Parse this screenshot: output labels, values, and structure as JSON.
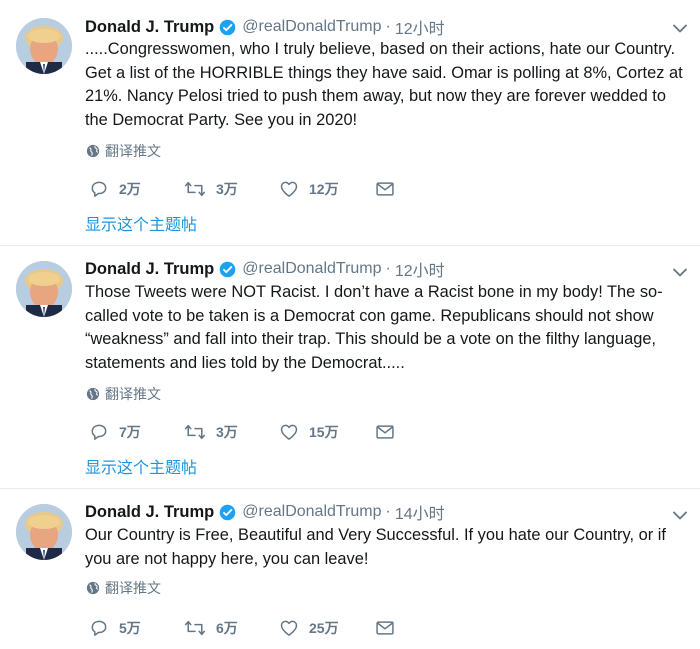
{
  "colors": {
    "accent": "#1b95e0",
    "muted": "#657786",
    "text": "#14171a",
    "divider": "#e6ecf0"
  },
  "tweets": [
    {
      "name": "Donald J. Trump",
      "handle": "@realDonaldTrump",
      "separator": "·",
      "time": "12小时",
      "text": ".....Congresswomen, who I truly believe, based on their actions, hate our Country. Get a list of the HORRIBLE things they have said. Omar is polling at 8%, Cortez at 21%. Nancy Pelosi tried to push them away, but now they are forever wedded to the Democrat Party. See you in 2020!",
      "translate": "翻译推文",
      "replies": "2万",
      "retweets": "3万",
      "likes": "12万",
      "show_thread": "显示这个主题帖"
    },
    {
      "name": "Donald J. Trump",
      "handle": "@realDonaldTrump",
      "separator": "·",
      "time": "12小时",
      "text": "Those Tweets were NOT Racist. I don’t have a Racist bone in my body! The so-called vote to be taken is a Democrat con game. Republicans should not show “weakness” and fall into their trap. This should be a vote on the filthy language, statements and lies told by the Democrat.....",
      "translate": "翻译推文",
      "replies": "7万",
      "retweets": "3万",
      "likes": "15万",
      "show_thread": "显示这个主题帖"
    },
    {
      "name": "Donald J. Trump",
      "handle": "@realDonaldTrump",
      "separator": "·",
      "time": "14小时",
      "text": "Our Country is Free, Beautiful and Very Successful. If you hate our Country, or if you are not happy here, you can leave!",
      "translate": "翻译推文",
      "replies": "5万",
      "retweets": "6万",
      "likes": "25万"
    }
  ],
  "icons": {
    "verified": "verified-badge-icon",
    "caret": "chevron-down-icon",
    "globe": "globe-icon",
    "reply": "reply-icon",
    "retweet": "retweet-icon",
    "like": "heart-icon",
    "dm": "envelope-icon"
  }
}
